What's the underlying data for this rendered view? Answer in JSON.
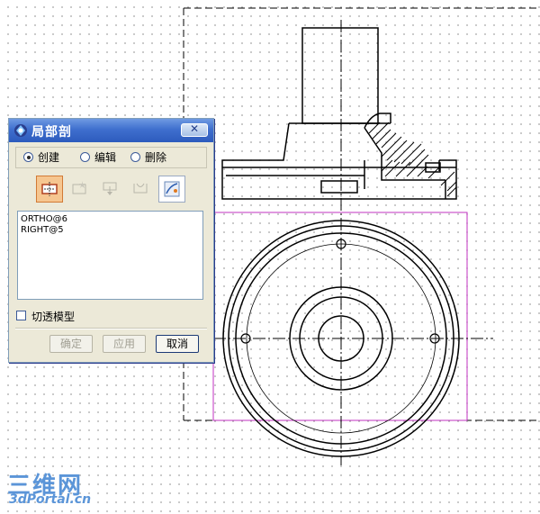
{
  "dialog": {
    "title": "局部剖",
    "close_symbol": "✕",
    "modes": [
      {
        "label": "创建",
        "selected": true
      },
      {
        "label": "编辑",
        "selected": false
      },
      {
        "label": "删除",
        "selected": false
      }
    ],
    "tools": [
      {
        "icon": "define-boundary-icon",
        "state": "active"
      },
      {
        "icon": "add-point-icon",
        "state": "disabled"
      },
      {
        "icon": "add-depth-point-icon",
        "state": "disabled"
      },
      {
        "icon": "extend-boundary-icon",
        "state": "disabled"
      },
      {
        "icon": "pick-curve-icon",
        "state": "pressed"
      }
    ],
    "references": [
      "ORTHO@6",
      "RIGHT@5"
    ],
    "cut_through_model": {
      "label": "切透模型",
      "checked": false
    },
    "buttons": {
      "ok": "确定",
      "apply": "应用",
      "cancel": "取消"
    }
  },
  "watermark": {
    "brand_cn": "三维网",
    "url": "3dPortal.cn"
  },
  "colors": {
    "selection_box": "#c030c0",
    "titlebar": "#3f6fce",
    "watermark": "#5b95d8"
  }
}
